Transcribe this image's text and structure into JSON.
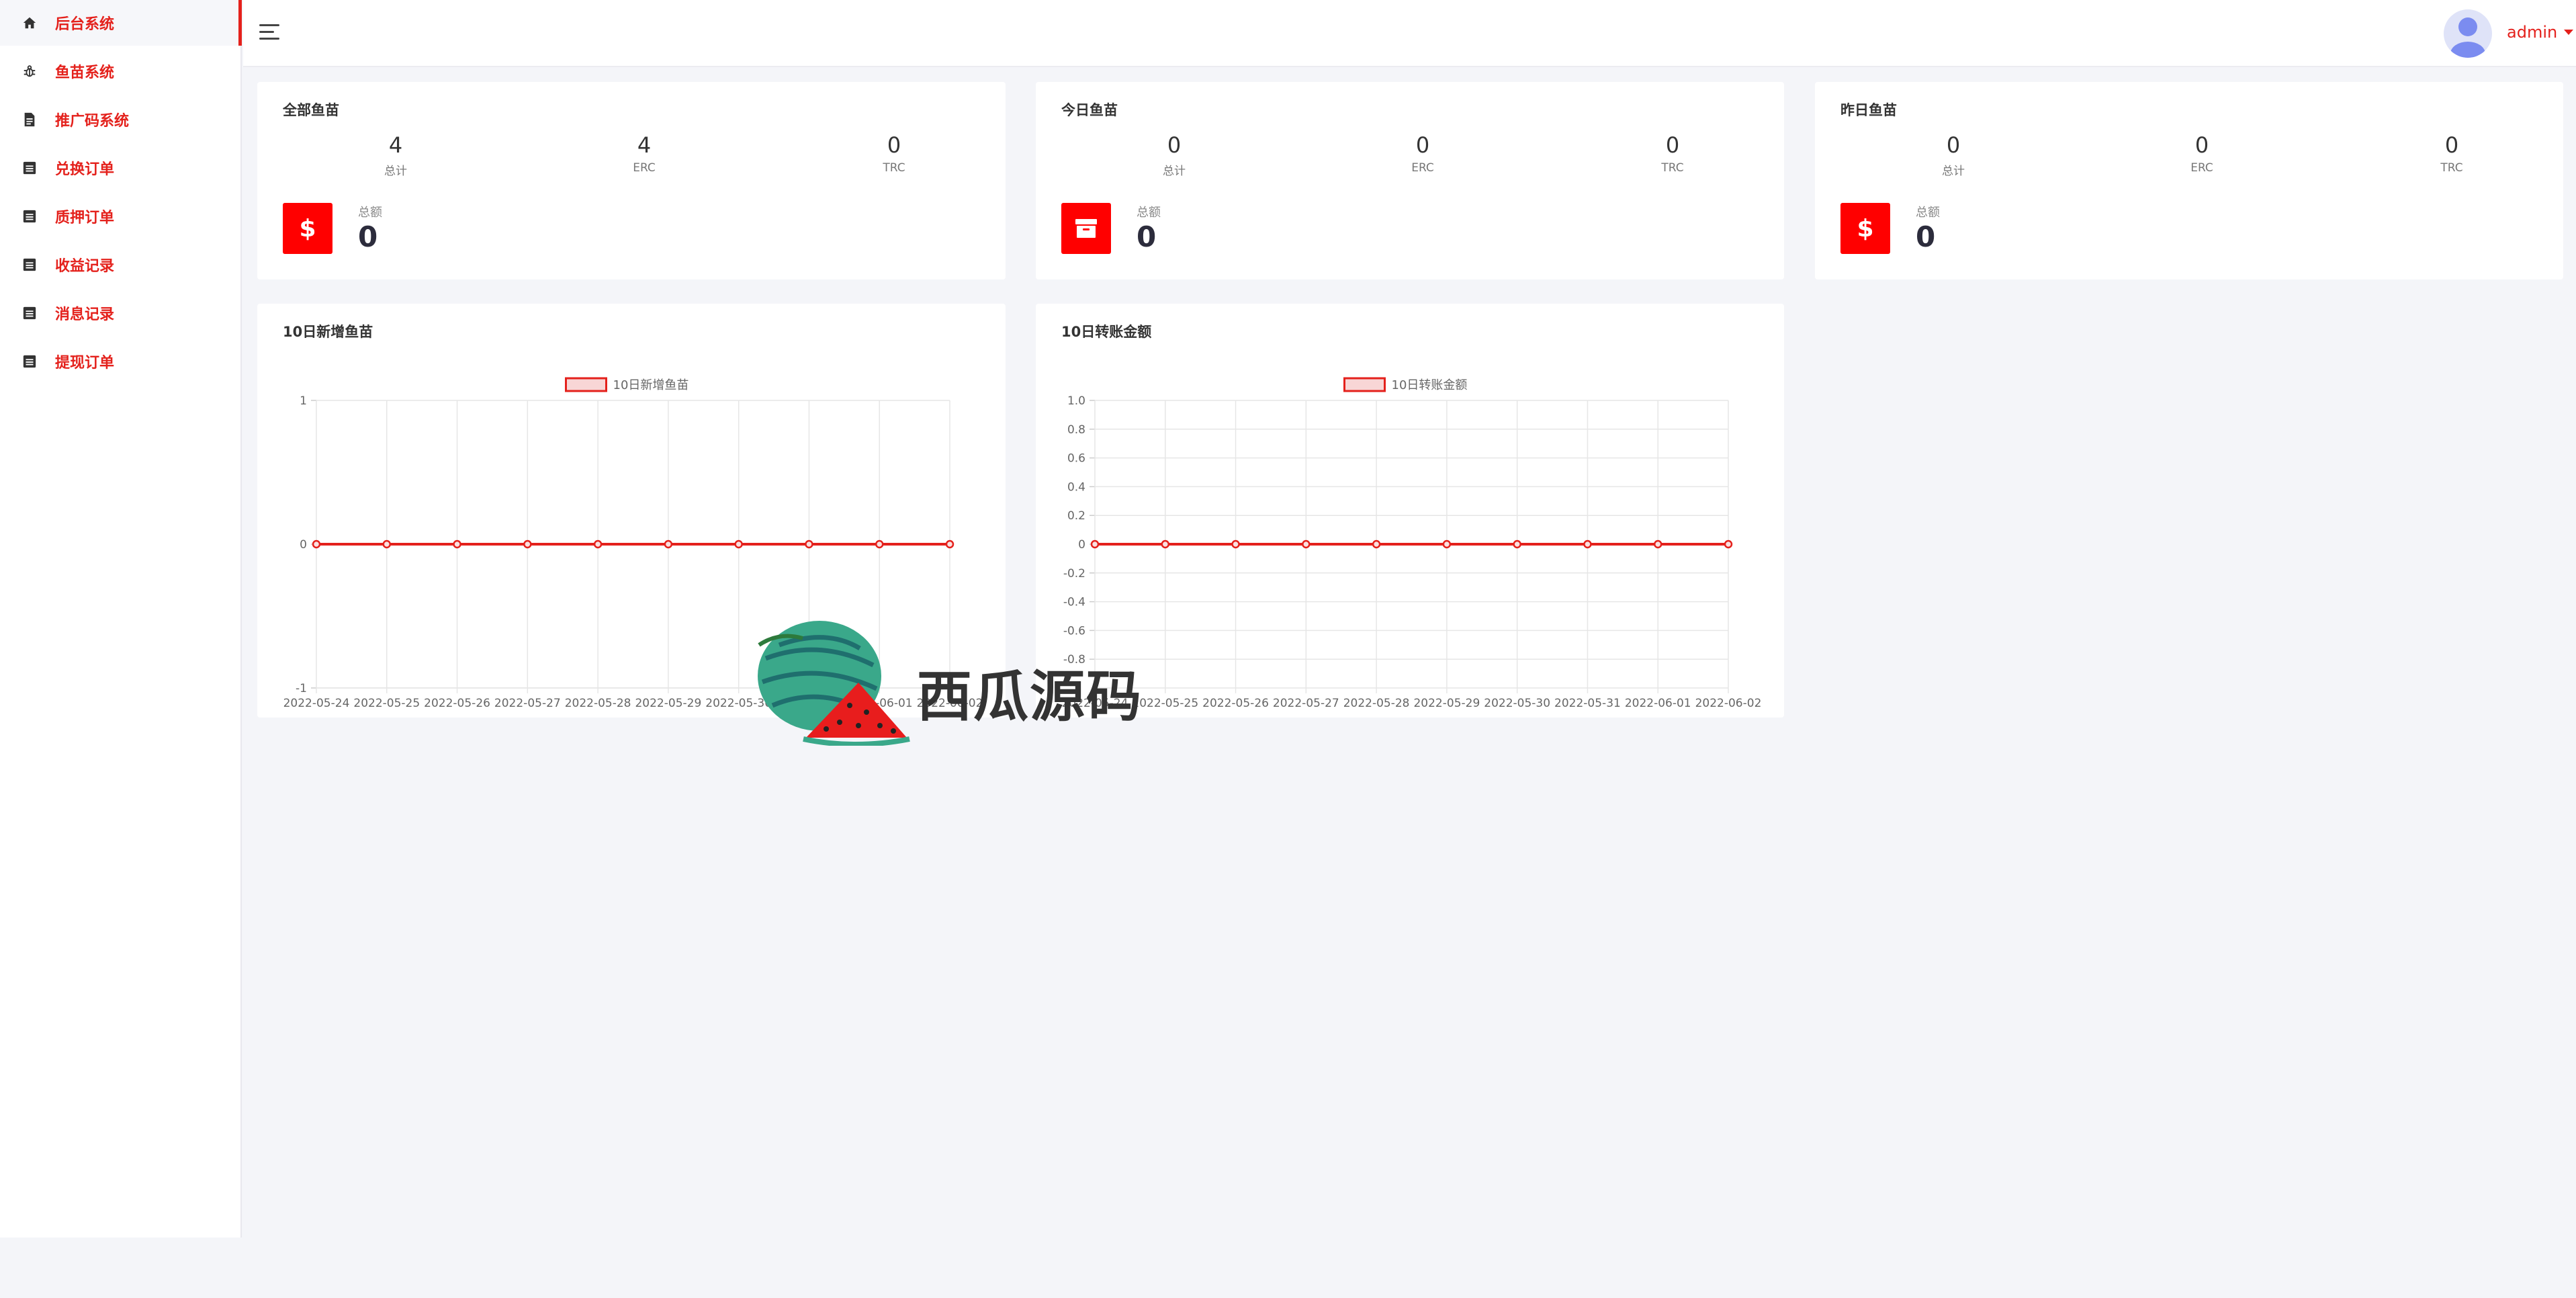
{
  "sidebar": {
    "items": [
      {
        "label": "后台系统",
        "icon": "home-icon",
        "active": true
      },
      {
        "label": "鱼苗系统",
        "icon": "bug-icon",
        "active": false
      },
      {
        "label": "推广码系统",
        "icon": "document-icon",
        "active": false
      },
      {
        "label": "兑换订单",
        "icon": "list-icon",
        "active": false
      },
      {
        "label": "质押订单",
        "icon": "list-icon",
        "active": false
      },
      {
        "label": "收益记录",
        "icon": "list-icon",
        "active": false
      },
      {
        "label": "消息记录",
        "icon": "list-icon",
        "active": false
      },
      {
        "label": "提现订单",
        "icon": "list-icon",
        "active": false
      }
    ]
  },
  "header": {
    "user": "admin",
    "accent": "#e4211c"
  },
  "cards": [
    {
      "title": "全部鱼苗",
      "stats": [
        {
          "value": "4",
          "label": "总计"
        },
        {
          "value": "4",
          "label": "ERC"
        },
        {
          "value": "0",
          "label": "TRC"
        }
      ],
      "badge_icon": "dollar-icon",
      "total_label": "总额",
      "total_value": "0"
    },
    {
      "title": "今日鱼苗",
      "stats": [
        {
          "value": "0",
          "label": "总计"
        },
        {
          "value": "0",
          "label": "ERC"
        },
        {
          "value": "0",
          "label": "TRC"
        }
      ],
      "badge_icon": "archive-icon",
      "total_label": "总额",
      "total_value": "0"
    },
    {
      "title": "昨日鱼苗",
      "stats": [
        {
          "value": "0",
          "label": "总计"
        },
        {
          "value": "0",
          "label": "ERC"
        },
        {
          "value": "0",
          "label": "TRC"
        }
      ],
      "badge_icon": "dollar-icon",
      "total_label": "总额",
      "total_value": "0"
    }
  ],
  "watermark": {
    "text": "西瓜源码"
  },
  "chart_data": [
    {
      "type": "line",
      "title": "10日新增鱼苗",
      "legend": "10日新增鱼苗",
      "x": [
        "2022-05-24",
        "2022-05-25",
        "2022-05-26",
        "2022-05-27",
        "2022-05-28",
        "2022-05-29",
        "2022-05-30",
        "2022-05-31",
        "2022-06-01",
        "2022-06-02"
      ],
      "values": [
        0,
        0,
        0,
        0,
        0,
        0,
        0,
        0,
        0,
        0
      ],
      "ylim": [
        -1,
        1
      ],
      "yticks": [
        1,
        0,
        -1
      ],
      "ytick_labels": [
        "1",
        "0",
        "-1"
      ],
      "grid": true,
      "legend_position": "top",
      "color": "#e4211c"
    },
    {
      "type": "line",
      "title": "10日转账金额",
      "legend": "10日转账金额",
      "x": [
        "2022-05-24",
        "2022-05-25",
        "2022-05-26",
        "2022-05-27",
        "2022-05-28",
        "2022-05-29",
        "2022-05-30",
        "2022-05-31",
        "2022-06-01",
        "2022-06-02"
      ],
      "values": [
        0,
        0,
        0,
        0,
        0,
        0,
        0,
        0,
        0,
        0
      ],
      "ylim": [
        -1,
        1
      ],
      "yticks": [
        1.0,
        0.8,
        0.6,
        0.4,
        0.2,
        0,
        -0.2,
        -0.4,
        -0.6,
        -0.8
      ],
      "ytick_labels": [
        "1.0",
        "0.8",
        "0.6",
        "0.4",
        "0.2",
        "0",
        "-0.2",
        "-0.4",
        "-0.6",
        "-0.8"
      ],
      "grid": true,
      "legend_position": "top",
      "color": "#e4211c"
    }
  ]
}
